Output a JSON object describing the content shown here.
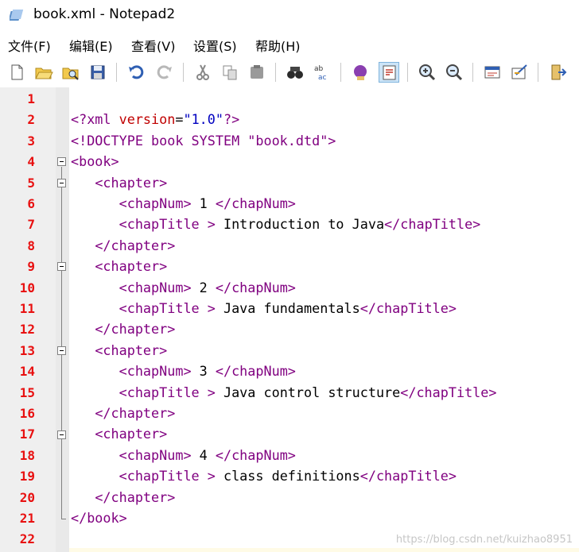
{
  "window": {
    "title": "book.xml - Notepad2"
  },
  "menu": [
    {
      "label": "文件(F)"
    },
    {
      "label": "编辑(E)"
    },
    {
      "label": "查看(V)"
    },
    {
      "label": "设置(S)"
    },
    {
      "label": "帮助(H)"
    }
  ],
  "toolbar": [
    {
      "icon": "new-file-icon"
    },
    {
      "icon": "open-folder-icon"
    },
    {
      "icon": "browse-icon"
    },
    {
      "icon": "save-icon"
    },
    {
      "icon": "undo-icon"
    },
    {
      "icon": "redo-icon"
    },
    {
      "icon": "cut-icon"
    },
    {
      "icon": "copy-icon"
    },
    {
      "icon": "paste-icon"
    },
    {
      "icon": "find-icon"
    },
    {
      "icon": "replace-icon"
    },
    {
      "icon": "scheme-icon"
    },
    {
      "icon": "word-wrap-icon"
    },
    {
      "icon": "zoom-in-icon"
    },
    {
      "icon": "zoom-out-icon"
    },
    {
      "icon": "view-icon"
    },
    {
      "icon": "settings-icon"
    },
    {
      "icon": "exit-icon"
    }
  ],
  "lines": [
    {
      "n": "1",
      "parts": []
    },
    {
      "n": "2",
      "parts": [
        {
          "c": "pi",
          "t": "<?xml "
        },
        {
          "c": "attr",
          "t": "version"
        },
        {
          "c": "",
          "t": "="
        },
        {
          "c": "str",
          "t": "\"1.0\""
        },
        {
          "c": "pi",
          "t": "?>"
        }
      ]
    },
    {
      "n": "3",
      "parts": [
        {
          "c": "tag",
          "t": "<!DOCTYPE book SYSTEM \"book.dtd\">"
        }
      ]
    },
    {
      "n": "4",
      "parts": [
        {
          "c": "tag",
          "t": "<book>"
        }
      ]
    },
    {
      "n": "5",
      "parts": [
        {
          "c": "",
          "t": "   "
        },
        {
          "c": "tag",
          "t": "<chapter>"
        }
      ]
    },
    {
      "n": "6",
      "parts": [
        {
          "c": "",
          "t": "      "
        },
        {
          "c": "tag",
          "t": "<chapNum>"
        },
        {
          "c": "",
          "t": " 1 "
        },
        {
          "c": "tag",
          "t": "</chapNum>"
        }
      ]
    },
    {
      "n": "7",
      "parts": [
        {
          "c": "",
          "t": "      "
        },
        {
          "c": "tag",
          "t": "<chapTitle >"
        },
        {
          "c": "",
          "t": " Introduction to Java"
        },
        {
          "c": "tag",
          "t": "</chapTitle>"
        }
      ]
    },
    {
      "n": "8",
      "parts": [
        {
          "c": "",
          "t": "   "
        },
        {
          "c": "tag",
          "t": "</chapter>"
        }
      ]
    },
    {
      "n": "9",
      "parts": [
        {
          "c": "",
          "t": "   "
        },
        {
          "c": "tag",
          "t": "<chapter>"
        }
      ]
    },
    {
      "n": "10",
      "parts": [
        {
          "c": "",
          "t": "      "
        },
        {
          "c": "tag",
          "t": "<chapNum>"
        },
        {
          "c": "",
          "t": " 2 "
        },
        {
          "c": "tag",
          "t": "</chapNum>"
        }
      ]
    },
    {
      "n": "11",
      "parts": [
        {
          "c": "",
          "t": "      "
        },
        {
          "c": "tag",
          "t": "<chapTitle >"
        },
        {
          "c": "",
          "t": " Java fundamentals"
        },
        {
          "c": "tag",
          "t": "</chapTitle>"
        }
      ]
    },
    {
      "n": "12",
      "parts": [
        {
          "c": "",
          "t": "   "
        },
        {
          "c": "tag",
          "t": "</chapter>"
        }
      ]
    },
    {
      "n": "13",
      "parts": [
        {
          "c": "",
          "t": "   "
        },
        {
          "c": "tag",
          "t": "<chapter>"
        }
      ]
    },
    {
      "n": "14",
      "parts": [
        {
          "c": "",
          "t": "      "
        },
        {
          "c": "tag",
          "t": "<chapNum>"
        },
        {
          "c": "",
          "t": " 3 "
        },
        {
          "c": "tag",
          "t": "</chapNum>"
        }
      ]
    },
    {
      "n": "15",
      "parts": [
        {
          "c": "",
          "t": "      "
        },
        {
          "c": "tag",
          "t": "<chapTitle >"
        },
        {
          "c": "",
          "t": " Java control structure"
        },
        {
          "c": "tag",
          "t": "</chapTitle>"
        }
      ]
    },
    {
      "n": "16",
      "parts": [
        {
          "c": "",
          "t": "   "
        },
        {
          "c": "tag",
          "t": "</chapter>"
        }
      ]
    },
    {
      "n": "17",
      "parts": [
        {
          "c": "",
          "t": "   "
        },
        {
          "c": "tag",
          "t": "<chapter>"
        }
      ]
    },
    {
      "n": "18",
      "parts": [
        {
          "c": "",
          "t": "      "
        },
        {
          "c": "tag",
          "t": "<chapNum>"
        },
        {
          "c": "",
          "t": " 4 "
        },
        {
          "c": "tag",
          "t": "</chapNum>"
        }
      ]
    },
    {
      "n": "19",
      "parts": [
        {
          "c": "",
          "t": "      "
        },
        {
          "c": "tag",
          "t": "<chapTitle >"
        },
        {
          "c": "",
          "t": " class definitions"
        },
        {
          "c": "tag",
          "t": "</chapTitle>"
        }
      ]
    },
    {
      "n": "20",
      "parts": [
        {
          "c": "",
          "t": "   "
        },
        {
          "c": "tag",
          "t": "</chapter>"
        }
      ]
    },
    {
      "n": "21",
      "parts": [
        {
          "c": "tag",
          "t": "</book>"
        }
      ]
    },
    {
      "n": "22",
      "parts": []
    }
  ],
  "watermark": "https://blog.csdn.net/kuizhao8951",
  "colors": {
    "line_number": "#e81010",
    "tag": "#800080",
    "attribute": "#c00000",
    "string": "#0000c0"
  }
}
